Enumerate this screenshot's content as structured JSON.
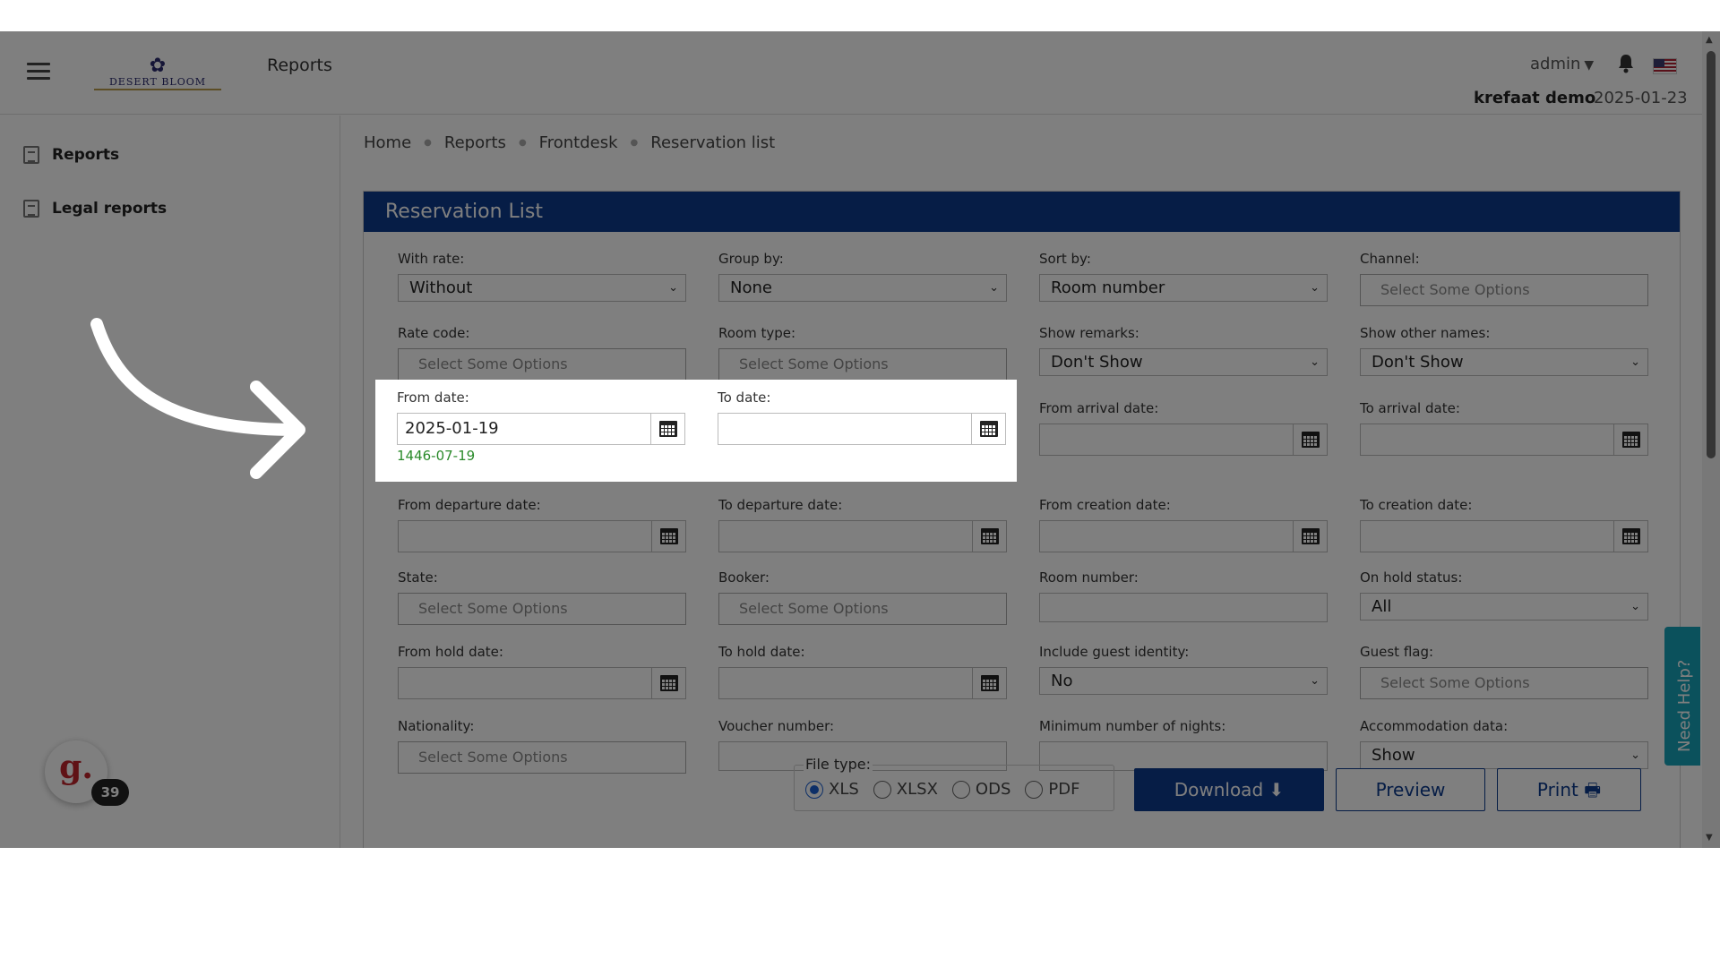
{
  "header": {
    "page_title": "Reports",
    "logo_text": "DESERT BLOOM",
    "admin_label": "admin",
    "user_name": "krefaat demo",
    "current_date": "2025-01-23"
  },
  "sidebar": {
    "items": [
      {
        "label": "Reports"
      },
      {
        "label": "Legal reports"
      }
    ],
    "badge_count": "39"
  },
  "breadcrumb": [
    "Home",
    "Reports",
    "Frontdesk",
    "Reservation list"
  ],
  "panel": {
    "title": "Reservation List",
    "fields": {
      "with_rate": {
        "label": "With rate:",
        "value": "Without"
      },
      "group_by": {
        "label": "Group by:",
        "value": "None"
      },
      "sort_by": {
        "label": "Sort by:",
        "value": "Room number"
      },
      "channel": {
        "label": "Channel:",
        "placeholder": "Select Some Options"
      },
      "rate_code": {
        "label": "Rate code:",
        "placeholder": "Select Some Options"
      },
      "room_type": {
        "label": "Room type:",
        "placeholder": "Select Some Options"
      },
      "show_remarks": {
        "label": "Show remarks:",
        "value": "Don't Show"
      },
      "show_other_names": {
        "label": "Show other names:",
        "value": "Don't Show"
      },
      "from_date": {
        "label": "From date:",
        "value": "2025-01-19",
        "hijri": "1446-07-19"
      },
      "to_date": {
        "label": "To date:",
        "value": ""
      },
      "from_arrival_date": {
        "label": "From arrival date:",
        "value": ""
      },
      "to_arrival_date": {
        "label": "To arrival date:",
        "value": ""
      },
      "from_departure_date": {
        "label": "From departure date:",
        "value": ""
      },
      "to_departure_date": {
        "label": "To departure date:",
        "value": ""
      },
      "from_creation_date": {
        "label": "From creation date:",
        "value": ""
      },
      "to_creation_date": {
        "label": "To creation date:",
        "value": ""
      },
      "state": {
        "label": "State:",
        "placeholder": "Select Some Options"
      },
      "booker": {
        "label": "Booker:",
        "placeholder": "Select Some Options"
      },
      "room_number": {
        "label": "Room number:",
        "value": ""
      },
      "on_hold_status": {
        "label": "On hold status:",
        "value": "All"
      },
      "from_hold_date": {
        "label": "From hold date:",
        "value": ""
      },
      "to_hold_date": {
        "label": "To hold date:",
        "value": ""
      },
      "include_guest_identity": {
        "label": "Include guest identity:",
        "value": "No"
      },
      "guest_flag": {
        "label": "Guest flag:",
        "placeholder": "Select Some Options"
      },
      "nationality": {
        "label": "Nationality:",
        "placeholder": "Select Some Options"
      },
      "voucher_number": {
        "label": "Voucher number:",
        "value": ""
      },
      "min_nights": {
        "label": "Minimum number of nights:",
        "value": ""
      },
      "accommodation_data": {
        "label": "Accommodation data:",
        "value": "Show"
      }
    },
    "file_type": {
      "legend": "File type:",
      "options": [
        "XLS",
        "XLSX",
        "ODS",
        "PDF"
      ],
      "selected": "XLS"
    },
    "buttons": {
      "download": "Download",
      "preview": "Preview",
      "print": "Print"
    }
  },
  "need_help": "Need Help?",
  "colors": {
    "primary": "#0d3a8c",
    "hijri_text": "#2a8a2a",
    "help_tab": "#17a2b8"
  }
}
